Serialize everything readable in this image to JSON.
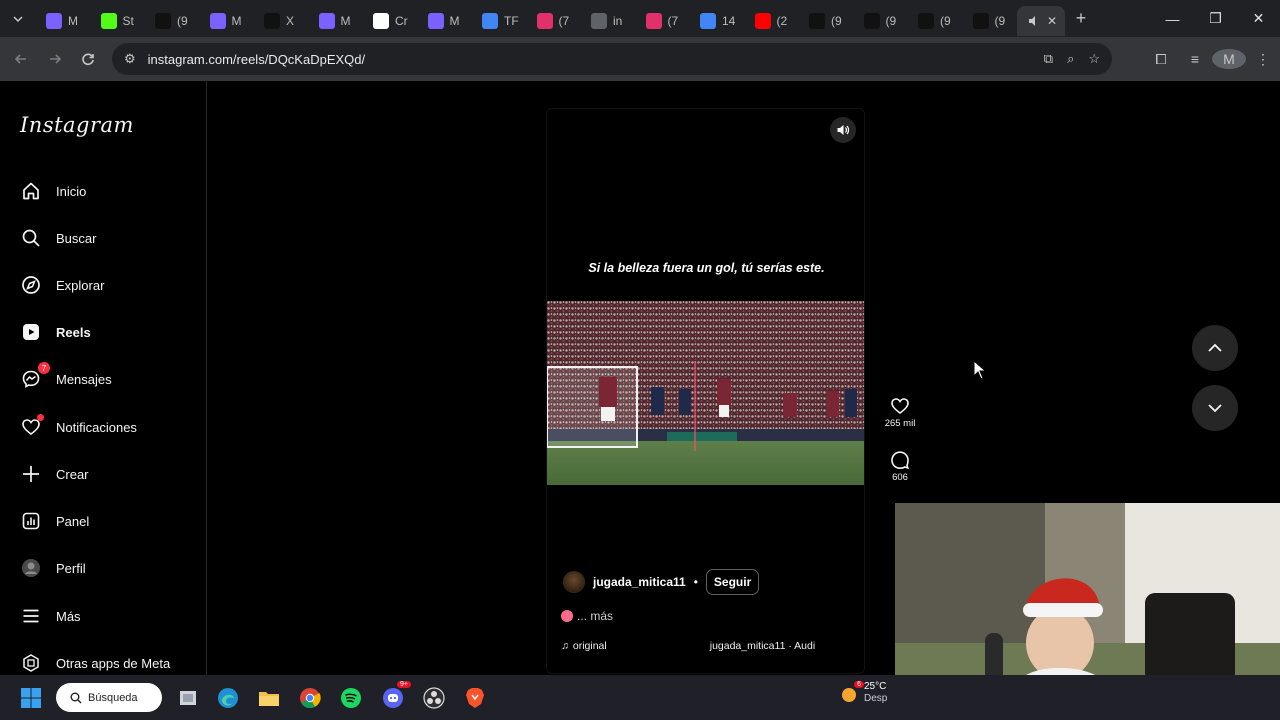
{
  "browser": {
    "tabs": [
      {
        "label": "M",
        "color": "#7b61ff"
      },
      {
        "label": "St",
        "color": "#53fc18"
      },
      {
        "label": "(9",
        "color": "#111111"
      },
      {
        "label": "M",
        "color": "#7b61ff"
      },
      {
        "label": "X",
        "color": "#111111"
      },
      {
        "label": "M",
        "color": "#7b61ff"
      },
      {
        "label": "Cr",
        "color": "#ffffff"
      },
      {
        "label": "M",
        "color": "#7b61ff"
      },
      {
        "label": "TF",
        "color": "#4285f4"
      },
      {
        "label": "(7",
        "color": "#e1306c"
      },
      {
        "label": "in",
        "color": "#5f6368"
      },
      {
        "label": "(7",
        "color": "#e1306c"
      },
      {
        "label": "14",
        "color": "#4285f4"
      },
      {
        "label": "(2",
        "color": "#ff0000"
      },
      {
        "label": "(9",
        "color": "#111111"
      },
      {
        "label": "(9",
        "color": "#111111"
      },
      {
        "label": "(9",
        "color": "#111111"
      },
      {
        "label": "(9",
        "color": "#111111"
      }
    ],
    "url": "instagram.com/reels/DQcKaDpEXQd/",
    "profile_initial": "M"
  },
  "sidebar": {
    "logo": "Instagram",
    "items": [
      {
        "label": "Inicio",
        "icon": "home-icon"
      },
      {
        "label": "Buscar",
        "icon": "search-icon"
      },
      {
        "label": "Explorar",
        "icon": "compass-icon"
      },
      {
        "label": "Reels",
        "icon": "reels-icon"
      },
      {
        "label": "Mensajes",
        "icon": "messenger-icon",
        "badge": "7"
      },
      {
        "label": "Notificaciones",
        "icon": "heart-icon"
      },
      {
        "label": "Crear",
        "icon": "plus-icon"
      },
      {
        "label": "Panel",
        "icon": "dashboard-icon"
      },
      {
        "label": "Perfil",
        "icon": "profile-avatar"
      },
      {
        "label": "Más",
        "icon": "menu-icon"
      },
      {
        "label": "Otras apps de Meta",
        "icon": "meta-apps-icon"
      }
    ]
  },
  "reel": {
    "caption": "Si la belleza fuera un gol, tú serías este.",
    "author": "jugada_mitica11",
    "separator": "•",
    "follow_label": "Seguir",
    "description_more": "... más",
    "audio_left": "original",
    "audio_right": "jugada_mitica11 · Audi"
  },
  "actions": {
    "likes": "265 mil",
    "comments": "606"
  },
  "taskbar": {
    "search_label": "Búsqueda",
    "discord_badge": "9+",
    "weather_badge": "6",
    "temperature": "25°C",
    "weather_text": "Desp"
  },
  "colors": {
    "background": "#000000",
    "notification_red": "#ff3040",
    "chrome_dark": "#202124"
  }
}
